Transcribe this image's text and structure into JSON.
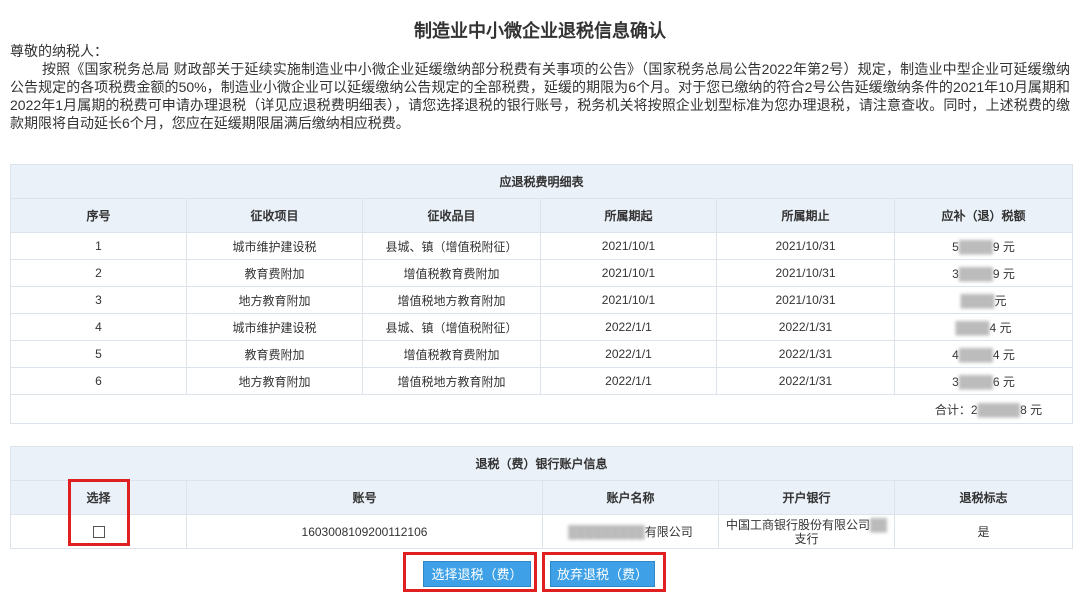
{
  "page": {
    "title": "制造业中小微企业退税信息确认",
    "salutation": "尊敬的纳税人：",
    "notice": "按照《国家税务总局 财政部关于延续实施制造业中小微企业延缓缴纳部分税费有关事项的公告》（国家税务总局公告2022年第2号）规定，制造业中型企业可延缓缴纳公告规定的各项税费金额的50%，制造业小微企业可以延缓缴纳公告规定的全部税费，延缓的期限为6个月。对于您已缴纳的符合2号公告延缓缴纳条件的2021年10月属期和2022年1月属期的税费可申请办理退税（详见应退税费明细表），请您选择退税的银行账号，税务机关将按照企业划型标准为您办理退税，请注意查收。同时，上述税费的缴款期限将自动延长6个月，您应在延缓期限届满后缴纳相应税费。"
  },
  "details": {
    "caption": "应退税费明细表",
    "headers": [
      "序号",
      "征收项目",
      "征收品目",
      "所属期起",
      "所属期止",
      "应补（退）税额"
    ],
    "rows": [
      {
        "no": "1",
        "item": "城市维护建设税",
        "sub": "县城、镇（增值税附征）",
        "start": "2021/10/1",
        "end": "2021/10/31",
        "amount_masked": "5",
        "amount_tail": "9 元"
      },
      {
        "no": "2",
        "item": "教育费附加",
        "sub": "增值税教育费附加",
        "start": "2021/10/1",
        "end": "2021/10/31",
        "amount_masked": "3",
        "amount_tail": "9 元"
      },
      {
        "no": "3",
        "item": "地方教育附加",
        "sub": "增值税地方教育附加",
        "start": "2021/10/1",
        "end": "2021/10/31",
        "amount_masked": "",
        "amount_tail": "元"
      },
      {
        "no": "4",
        "item": "城市维护建设税",
        "sub": "县城、镇（增值税附征）",
        "start": "2022/1/1",
        "end": "2022/1/31",
        "amount_masked": "",
        "amount_tail": "4 元"
      },
      {
        "no": "5",
        "item": "教育费附加",
        "sub": "增值税教育费附加",
        "start": "2022/1/1",
        "end": "2022/1/31",
        "amount_masked": "4",
        "amount_tail": "4 元"
      },
      {
        "no": "6",
        "item": "地方教育附加",
        "sub": "增值税地方教育附加",
        "start": "2022/1/1",
        "end": "2022/1/31",
        "amount_masked": "3",
        "amount_tail": "6 元"
      }
    ],
    "total_label": "合计：2",
    "total_tail": "8 元"
  },
  "bank": {
    "caption": "退税（费）银行账户信息",
    "headers": [
      "选择",
      "账号",
      "账户名称",
      "开户银行",
      "退税标志"
    ],
    "row": {
      "account_no": "1603008109200112106",
      "account_name_tail": "有限公司",
      "bank_name": "中国工商银行股份有限公司",
      "bank_name_line2": "支行",
      "flag": "是"
    }
  },
  "actions": {
    "select_refund": "选择退税（费）",
    "abandon_refund": "放弃退税（费）"
  },
  "colors": {
    "header_bg": "#eaf1f8",
    "button_bg": "#3ea0e6",
    "highlight_border": "#e02020"
  }
}
